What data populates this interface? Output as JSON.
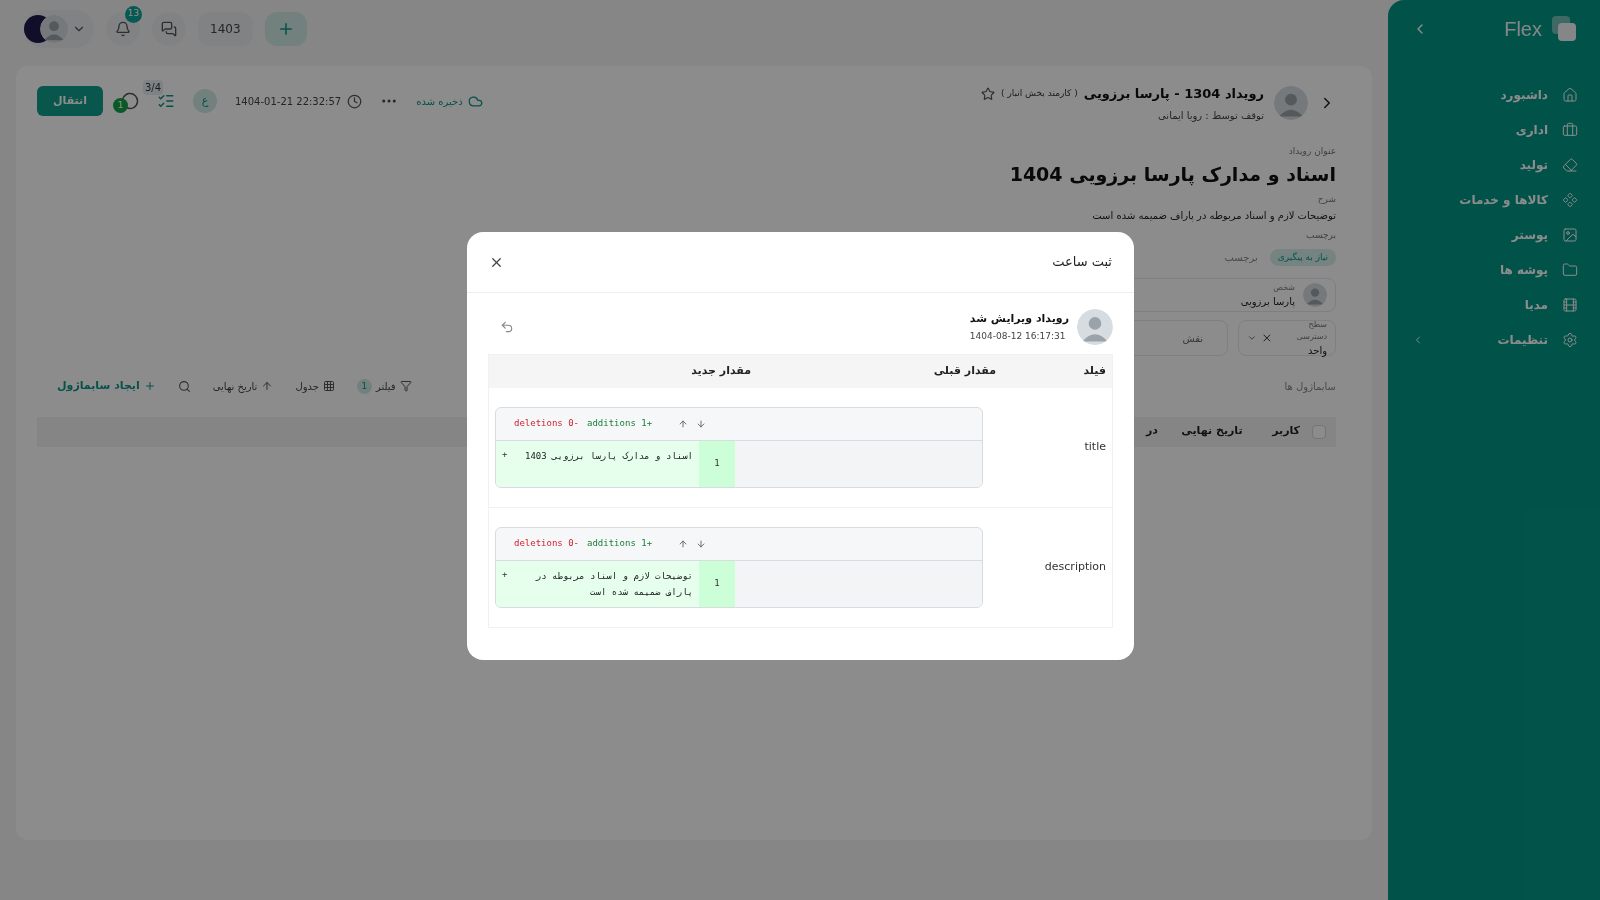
{
  "topbar": {
    "notification_count": "13",
    "year_button": "1403"
  },
  "event": {
    "title": "رویداد 1304 - پارسا برزویی",
    "role": "( کارمند بخش انبار )",
    "starred": false,
    "stopped_by": "توقف توسط : رویا ایمانی"
  },
  "toolbar": {
    "transfer_button": "انتقال",
    "comment_count": "1",
    "checklist_count": "3/4",
    "assignee_initial": "ع",
    "timestamp": "1404-01-21 22:32:57",
    "save_status": "ذخیره شده"
  },
  "fields": {
    "title_label": "عنوان رویداد",
    "title": "اسناد و مدارک پارسا برزویی 1404",
    "description_label": "شرح",
    "description": "توضیحات لازم و اسناد مربوطه در پاراف ضمیمه شده است",
    "tags_label": "برچسب",
    "tags": [
      {
        "label": "نیاز به پیگیری"
      }
    ],
    "tag_placeholder": "برچسب",
    "person": {
      "label": "شخص",
      "name": "پارسا برزویی"
    },
    "access_level": {
      "label": "سطح دسترسی",
      "value": "واحد"
    },
    "role_placeholder": "نقش"
  },
  "subtasks": {
    "title": "سابماژول ها",
    "create_button": "ایجاد سابماژول",
    "sort_label": "تاریخ نهایی",
    "view_label": "جدول",
    "filter": {
      "label": "فیلتر",
      "count": "1"
    },
    "select_all": {
      "checked": false
    },
    "columns": [
      "کاربر",
      "تاریخ نهایی",
      "در"
    ]
  },
  "sidebar": {
    "brand": "Flex",
    "items": [
      {
        "label": "داشبورد",
        "kind": "link"
      },
      {
        "label": "اداری",
        "kind": "link"
      },
      {
        "label": "تولید",
        "kind": "link"
      },
      {
        "label": "کالاها و خدمات",
        "kind": "link"
      },
      {
        "label": "پوستر",
        "kind": "link"
      },
      {
        "label": "پوشه ها",
        "kind": "link"
      },
      {
        "label": "مدیا",
        "kind": "link"
      },
      {
        "label": "تنظیمات",
        "kind": "group"
      }
    ]
  },
  "modal": {
    "title": "ثبت ساعت",
    "entry": {
      "action": "رویداد ویرایش شد",
      "time": "1404-08-12 16:17:31"
    },
    "columns": [
      "فیلد",
      "مقدار قبلی",
      "مقدار جدید"
    ],
    "rows": [
      {
        "field": "title",
        "deletions": "deletions 0-",
        "additions": "additions 1+",
        "lines": [
          {
            "number": "1",
            "marker": "+",
            "text": "اسناد و مدارک پارسا برزویی 1403"
          }
        ]
      },
      {
        "field": "description",
        "deletions": "deletions 0-",
        "additions": "additions 1+",
        "lines": [
          {
            "number": "1",
            "marker": "+",
            "text": "توضیحات لازم و اسناد مربوطه در پاراف ضمیمه شده است"
          }
        ]
      }
    ]
  }
}
